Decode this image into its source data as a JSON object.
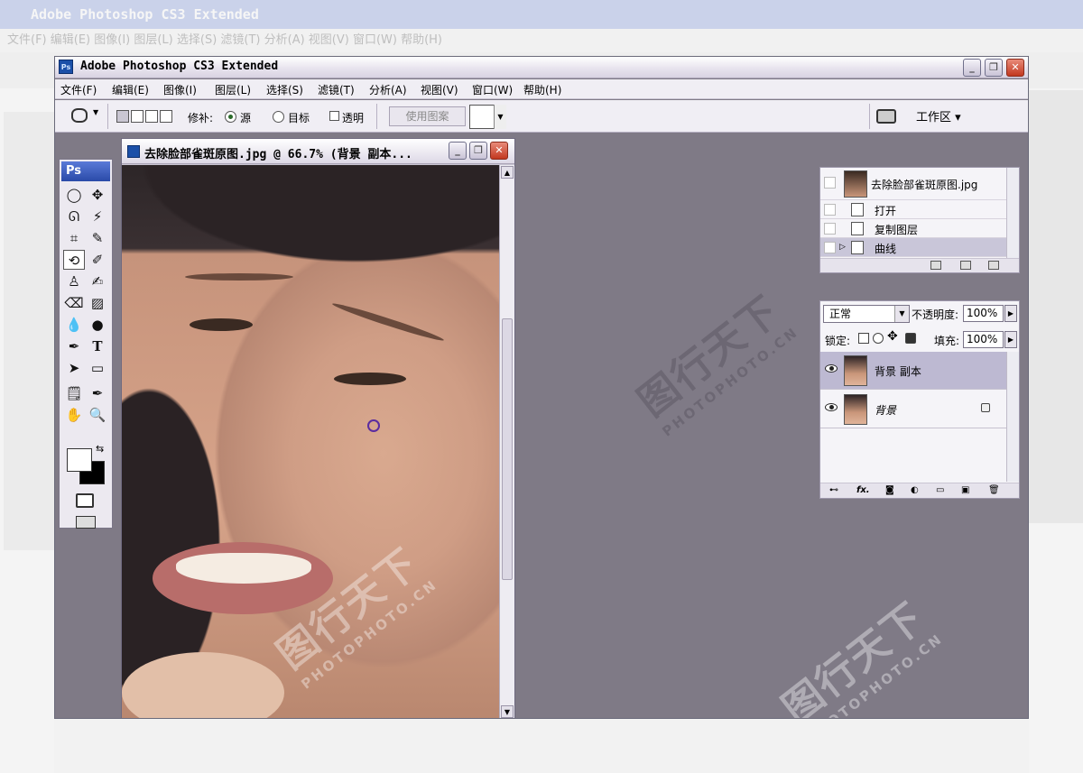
{
  "background_app": {
    "title": "Adobe Photoshop CS3 Extended",
    "menu": "文件(F) 编辑(E) 图像(I) 图层(L) 选择(S) 滤镜(T) 分析(A) 视图(V) 窗口(W) 帮助(H)"
  },
  "window": {
    "title": "Adobe Photoshop CS3 Extended",
    "icon_label": "Ps",
    "min_label": "_",
    "max_label": "❐",
    "close_label": "✕"
  },
  "menu": [
    {
      "label": "文件(F)"
    },
    {
      "label": "编辑(E)"
    },
    {
      "label": "图像(I)"
    },
    {
      "label": "图层(L)"
    },
    {
      "label": "选择(S)"
    },
    {
      "label": "滤镜(T)"
    },
    {
      "label": "分析(A)"
    },
    {
      "label": "视图(V)"
    },
    {
      "label": "窗口(W)"
    },
    {
      "label": "帮助(H)"
    }
  ],
  "options": {
    "patch_label": "修补:",
    "source_label": "源",
    "destination_label": "目标",
    "transparent_label": "透明",
    "use_pattern_label": "使用图案",
    "workspace_label": "工作区 ▾",
    "patch_mode": "源"
  },
  "tools_panel": {
    "title": "Ps"
  },
  "document": {
    "title": "去除脸部雀斑原图.jpg @ 66.7% (背景 副本..."
  },
  "history": {
    "snapshot": "去除脸部雀斑原图.jpg",
    "items": [
      {
        "label": "打开"
      },
      {
        "label": "复制图层"
      },
      {
        "label": "曲线"
      }
    ],
    "selected": "曲线"
  },
  "layers": {
    "blend_mode": "正常",
    "opacity_label": "不透明度:",
    "opacity_value": "100%",
    "lock_label": "锁定:",
    "fill_label": "填充:",
    "fill_value": "100%",
    "items": [
      {
        "name": "背景 副本"
      },
      {
        "name": "背景"
      }
    ],
    "selected": "背景 副本"
  },
  "watermark": {
    "text": "图行天下",
    "url": "PHOTOPHOTO.CN"
  },
  "colors": {
    "workspace": "#7f7a86",
    "selected_row": "#bdb9d2"
  }
}
